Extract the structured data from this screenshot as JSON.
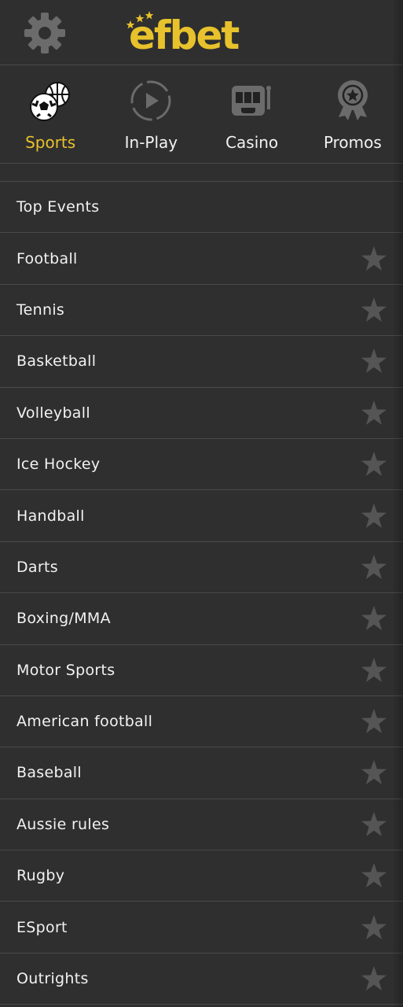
{
  "header": {
    "logo_text": "efbet",
    "settings_icon": "gear-icon"
  },
  "tabs": [
    {
      "label": "Sports",
      "icon": "sports-balls-icon",
      "active": true
    },
    {
      "label": "In-Play",
      "icon": "play-circle-icon",
      "active": false
    },
    {
      "label": "Casino",
      "icon": "slot-machine-icon",
      "active": false
    },
    {
      "label": "Promos",
      "icon": "award-ribbon-icon",
      "active": false
    }
  ],
  "list": [
    {
      "label": "Top Events",
      "favorite": false
    },
    {
      "label": "Football",
      "favorite": true
    },
    {
      "label": "Tennis",
      "favorite": true
    },
    {
      "label": "Basketball",
      "favorite": true
    },
    {
      "label": "Volleyball",
      "favorite": true
    },
    {
      "label": "Ice Hockey",
      "favorite": true
    },
    {
      "label": "Handball",
      "favorite": true
    },
    {
      "label": "Darts",
      "favorite": true
    },
    {
      "label": "Boxing/MMA",
      "favorite": true
    },
    {
      "label": "Motor Sports",
      "favorite": true
    },
    {
      "label": "American football",
      "favorite": true
    },
    {
      "label": "Baseball",
      "favorite": true
    },
    {
      "label": "Aussie rules",
      "favorite": true
    },
    {
      "label": "Rugby",
      "favorite": true
    },
    {
      "label": "ESport",
      "favorite": true
    },
    {
      "label": "Outrights",
      "favorite": true
    }
  ],
  "colors": {
    "accent": "#e8c22c",
    "background": "#2f2f2f",
    "divider": "#4a4a4a",
    "icon_gray": "#6b6b6b"
  }
}
